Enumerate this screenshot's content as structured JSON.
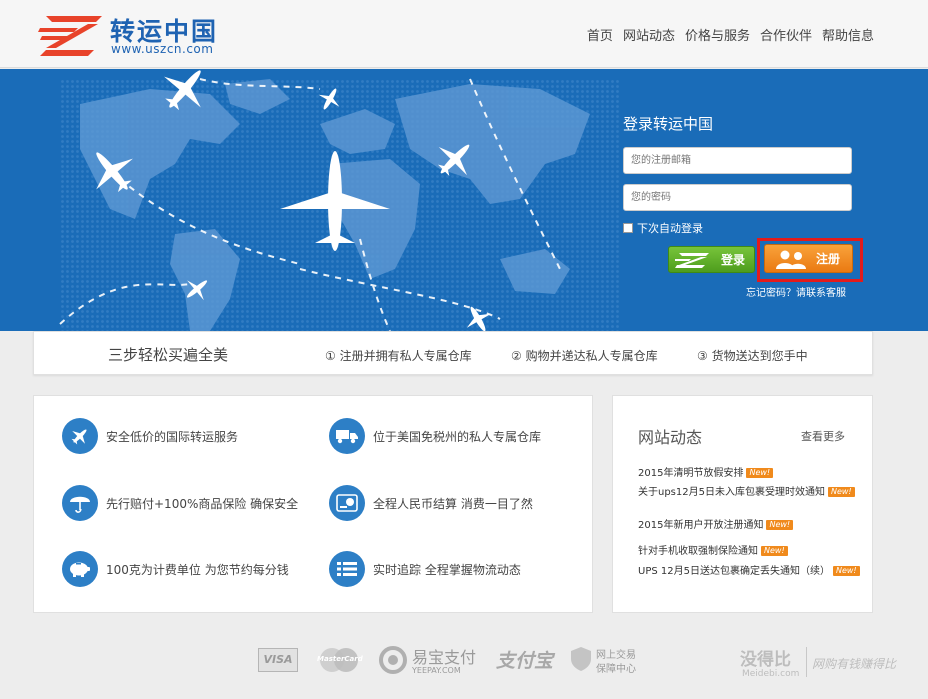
{
  "header": {
    "logo_cn": "转运中国",
    "logo_url": "www.uszcn.com",
    "nav": [
      "首页",
      "网站动态",
      "价格与服务",
      "合作伙伴",
      "帮助信息"
    ]
  },
  "login": {
    "title": "登录转运中国",
    "email_placeholder": "您的注册邮箱",
    "password_placeholder": "您的密码",
    "remember_label": "下次自动登录",
    "login_button": "登录",
    "register_button": "注册",
    "forgot": "忘记密码？请联系客服"
  },
  "steps": {
    "title": "三步轻松买遍全美",
    "items": [
      "① 注册并拥有私人专属仓库",
      "② 购物并递达私人专属仓库",
      "③ 货物送达到您手中"
    ]
  },
  "features": [
    {
      "icon": "airplane-icon",
      "text": "安全低价的国际转运服务"
    },
    {
      "icon": "truck-icon",
      "text": "位于美国免税州的私人专属仓库"
    },
    {
      "icon": "umbrella-icon",
      "text": "先行赔付+100%商品保险 确保安全"
    },
    {
      "icon": "rmb-card-icon",
      "text": "全程人民币结算 消费一目了然"
    },
    {
      "icon": "piggy-bank-icon",
      "text": "100克为计费单位 为您节约每分钱"
    },
    {
      "icon": "list-icon",
      "text": "实时追踪 全程掌握物流动态"
    }
  ],
  "news": {
    "title": "网站动态",
    "more": "查看更多",
    "badge": "New!",
    "items": [
      "2015年清明节放假安排",
      "关于ups12月5日未入库包裹受理时效通知",
      "2015年新用户开放注册通知",
      "针对手机收取强制保险通知",
      "UPS 12月5日送达包裹确定丢失通知（续）"
    ]
  },
  "footer": {
    "visa": "VISA",
    "mastercard": "MasterCard",
    "yeepay_cn": "易宝支付",
    "yeepay_en": "YEEPAY.COM",
    "alipay": "支付宝",
    "trust_line1": "网上交易",
    "trust_line2": "保障中心",
    "watermark_brand": "没得比",
    "watermark_url": "Meidebi.com",
    "watermark_slogan": "网购有钱赚得比"
  },
  "colors": {
    "banner_blue": "#1a6cb8",
    "accent_orange": "#f08a1c",
    "login_green": "#5bab25",
    "highlight_red": "#e31b1b"
  }
}
